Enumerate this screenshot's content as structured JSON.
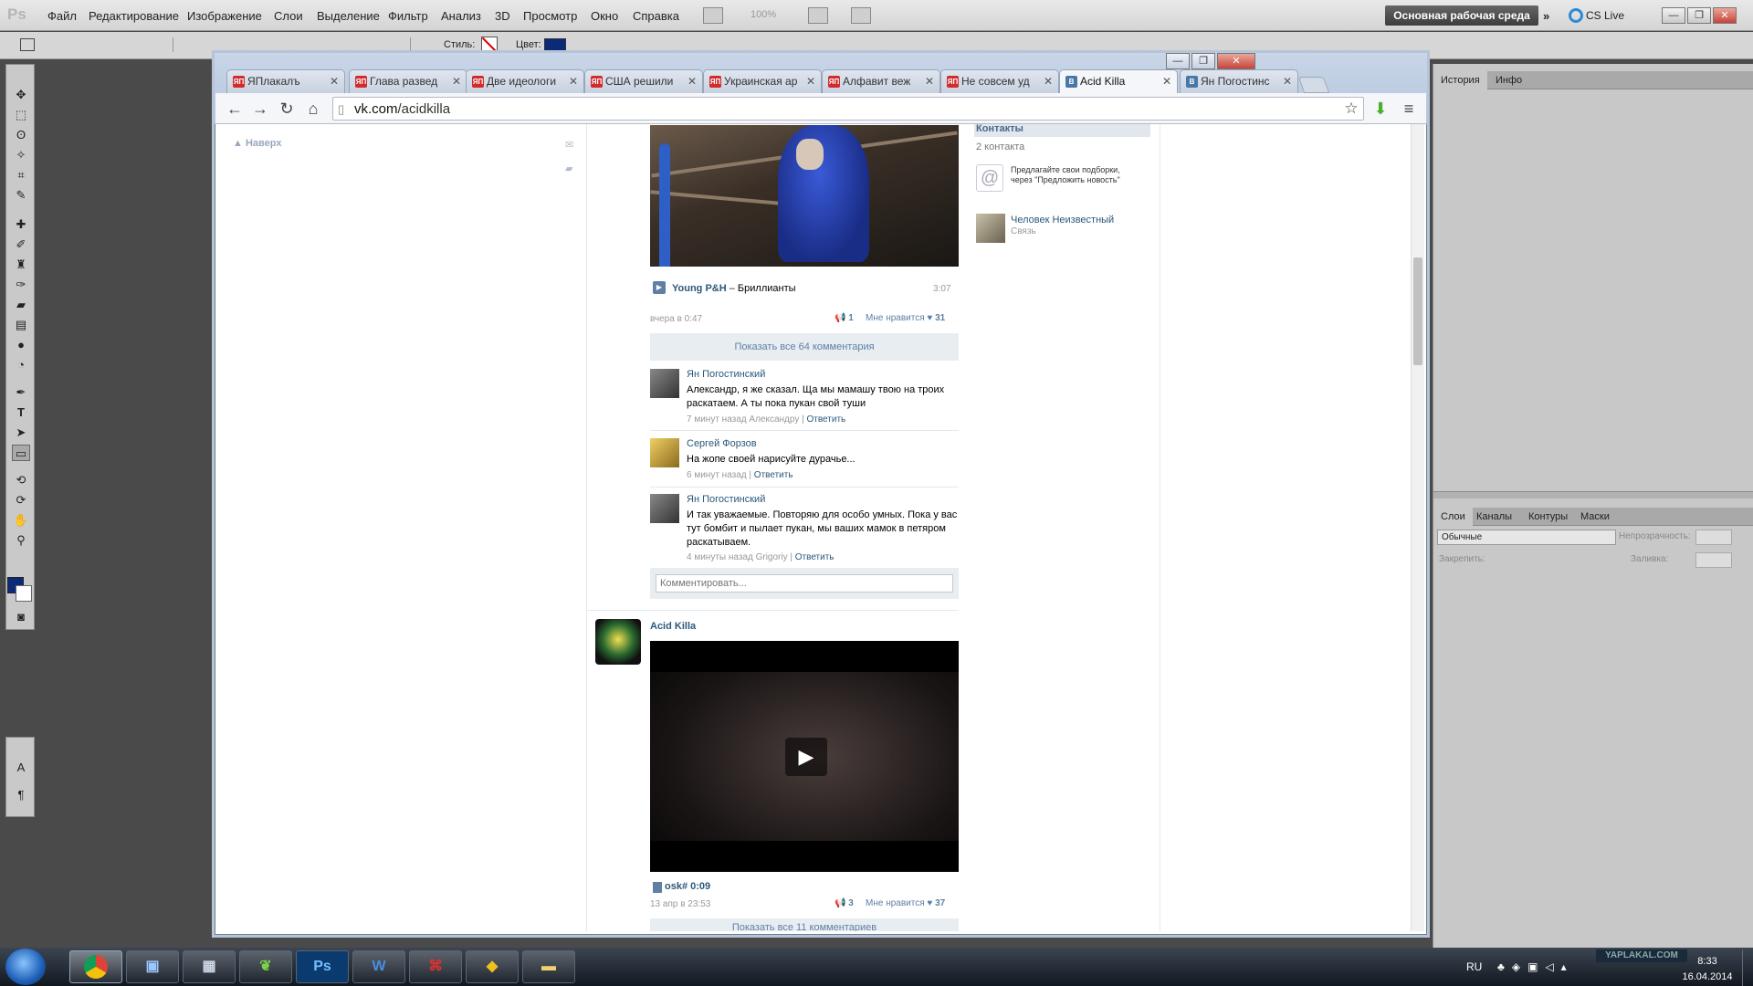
{
  "photoshop": {
    "logo": "Ps",
    "menu": [
      "Файл",
      "Редактирование",
      "Изображение",
      "Слои",
      "Выделение",
      "Фильтр",
      "Анализ",
      "3D",
      "Просмотр",
      "Окно",
      "Справка"
    ],
    "zoom": "100%",
    "workspace": "Основная рабочая среда",
    "cs_live": "CS Live",
    "options": {
      "style_label": "Стиль:",
      "color_label": "Цвет:",
      "color": "#0b2a78"
    },
    "panels": {
      "top_tabs": [
        "История",
        "Инфо"
      ],
      "layers_tabs": [
        "Слои",
        "Каналы",
        "Контуры",
        "Маски"
      ],
      "blend_mode": "Обычные",
      "opacity_label": "Непрозрачность:",
      "lock_label": "Закрепить:",
      "fill_label": "Заливка:"
    },
    "fg_color": "#0b2a78"
  },
  "browser": {
    "tabs": [
      {
        "label": "ЯПлакалъ",
        "icon": "ЯП"
      },
      {
        "label": "Глава развед",
        "icon": "ЯП"
      },
      {
        "label": "Две идеологи",
        "icon": "ЯП"
      },
      {
        "label": "США решили",
        "icon": "ЯП"
      },
      {
        "label": "Украинская ар",
        "icon": "ЯП"
      },
      {
        "label": "Алфавит веж",
        "icon": "ЯП"
      },
      {
        "label": "Не совсем уд",
        "icon": "ЯП"
      },
      {
        "label": "Acid Killa",
        "icon": "В"
      },
      {
        "label": "Ян Погостинс",
        "icon": "В"
      }
    ],
    "url_host": "vk.com",
    "url_path": "/acidkilla"
  },
  "vk": {
    "back_to_top": "Наверх",
    "audio": {
      "artist": "Young P&H",
      "title": "Бриллианты",
      "duration": "3:07"
    },
    "post1_meta": {
      "time": "вчера в 0:47",
      "reposts": "1",
      "likes_label": "Мне нравится",
      "likes": "31"
    },
    "show_all_comments": "Показать все 64 комментария",
    "comments": [
      {
        "author": "Ян Погостинский",
        "text": "Александр, я же сказал. Ща мы мамашу твою на троих раскатаем. А ты пока пукан свой туши",
        "time": "7 минут назад Александру",
        "reply": "Ответить"
      },
      {
        "author": "Сергей Форзов",
        "text": "На жопе своей нарисуйте дурачье...",
        "time": "6 минут назад",
        "reply": "Ответить"
      },
      {
        "author": "Ян Погостинский",
        "text": "И так уважаемые. Повторяю для особо умных. Пока у вас тут бомбит и пылает пукан, мы ваших мамок в петяром раскатываем.",
        "time": "4 минуты назад Grigoriy",
        "reply": "Ответить"
      }
    ],
    "comment_placeholder": "Комментировать...",
    "post2": {
      "author": "Acid Killa",
      "video_title": "osk# 0:09",
      "time": "13 апр в 23:53",
      "reposts": "3",
      "likes_label": "Мне нравится",
      "likes": "37",
      "show_all": "Показать все 11 комментариев"
    },
    "contacts": {
      "header": "Контакты",
      "count": "2 контакта",
      "suggest": "Предлагайте свои подборки, через \"Предложить новость\"",
      "person": "Человек Неизвестный",
      "person_role": "Связь"
    }
  },
  "taskbar": {
    "lang": "RU",
    "time": "8:33",
    "date": "16.04.2014",
    "watermark": "YAPLAKAL.COM"
  }
}
